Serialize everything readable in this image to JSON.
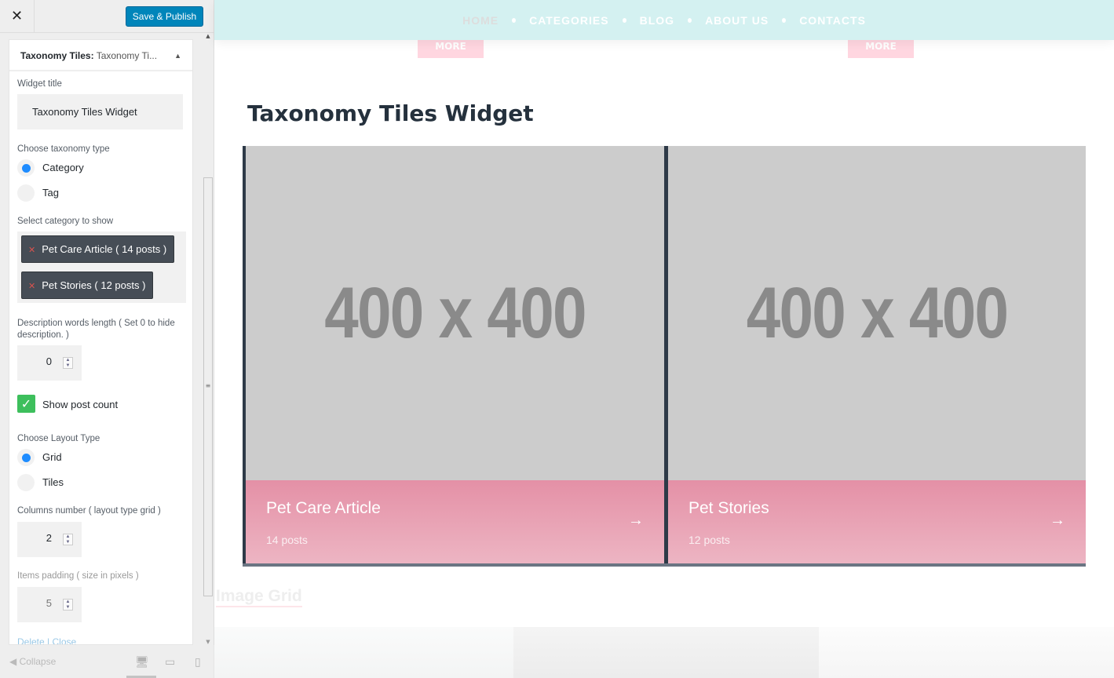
{
  "sidebar": {
    "close_label": "✕",
    "save_label": "Save & Publish",
    "panel_title_bold": "Taxonomy Tiles:",
    "panel_title_rest": " Taxonomy Ti...",
    "widget_title_label": "Widget title",
    "widget_title_value": "Taxonomy Tiles Widget",
    "taxonomy_label": "Choose taxonomy type",
    "taxonomy_options": [
      "Category",
      "Tag"
    ],
    "taxonomy_selected": "Category",
    "category_label": "Select category to show",
    "selected_categories": [
      "Pet Care Article ( 14 posts )",
      "Pet Stories ( 12 posts )"
    ],
    "desc_label": "Description words length ( Set 0 to hide description. )",
    "desc_value": "0",
    "show_count_label": "Show post count",
    "show_count_checked": true,
    "layout_label": "Choose Layout Type",
    "layout_options": [
      "Grid",
      "Tiles"
    ],
    "layout_selected": "Grid",
    "columns_label": "Columns number ( layout type grid )",
    "columns_value": "2",
    "padding_label": "Items padding ( size in pixels )",
    "padding_value": "5",
    "delete_label": "Delete",
    "close_link_label": "Close",
    "collapse_label": "Collapse"
  },
  "preview": {
    "nav": [
      "HOME",
      "CATEGORIES",
      "BLOG",
      "ABOUT US",
      "CONTACTS"
    ],
    "more_label": "MORE",
    "widget_title": "Taxonomy Tiles Widget",
    "tiles": [
      {
        "placeholder": "400 x 400",
        "title": "Pet Care Article",
        "count": "14 posts"
      },
      {
        "placeholder": "400 x 400",
        "title": "Pet Stories",
        "count": "12 posts"
      }
    ],
    "next_section": "Image Grid"
  }
}
